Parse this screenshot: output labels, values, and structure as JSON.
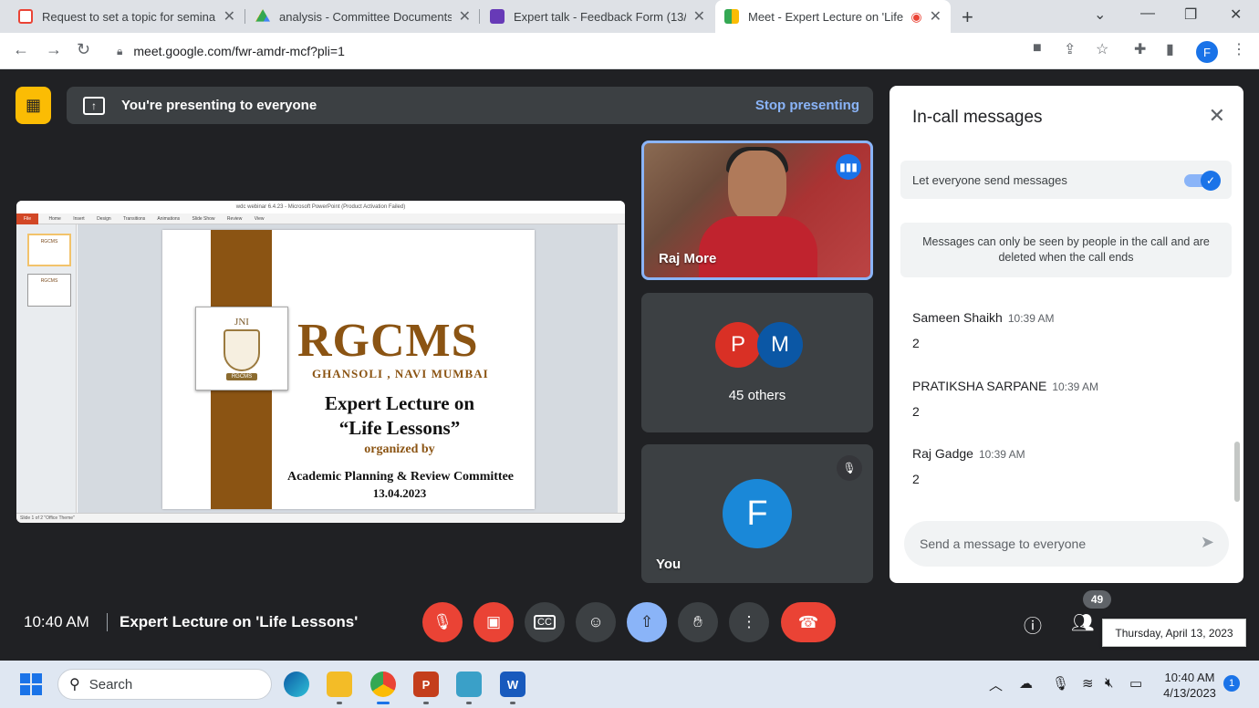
{
  "browser": {
    "tabs": [
      {
        "title": "Request to set a topic for semina",
        "favicon_color": "#ea4335"
      },
      {
        "title": "analysis - Committee Documents",
        "favicon_color": "#34a853"
      },
      {
        "title": "Expert talk - Feedback Form (13/",
        "favicon_color": "#673ab7"
      },
      {
        "title": "Meet - Expert Lecture on 'Life",
        "favicon_color": "#00897b"
      }
    ],
    "new_tab": "+",
    "url": "meet.google.com/fwr-amdr-mcf?pli=1",
    "profile_initial": "F"
  },
  "presenting": {
    "message": "You're presenting to everyone",
    "stop_label": "Stop presenting"
  },
  "slide": {
    "window_title": "wdc webinar 6.4.23 - Microsoft PowerPoint (Product Activation Failed)",
    "ribbon": [
      "File",
      "Home",
      "Insert",
      "Design",
      "Transitions",
      "Animations",
      "Slide Show",
      "Review",
      "View"
    ],
    "status": "Slide 1 of 2   \"Office Theme\"",
    "logo_top": "JNI",
    "logo_bottom": "RGCMS",
    "brand": "RGCMS",
    "location": "GHANSOLI , NAVI MUMBAI",
    "line1": "Expert Lecture on",
    "line2": "“Life Lessons”",
    "line3": "organized by",
    "line4": "Academic Planning & Review Committee",
    "line5": "13.04.2023",
    "thumb1": "RGCMS",
    "thumb2": "RGCMS"
  },
  "tiles": {
    "speaker_name": "Raj More",
    "others_initials": [
      "P",
      "M"
    ],
    "others_colors": [
      "#d93025",
      "#0b57a5"
    ],
    "others_label": "45 others",
    "you_initial": "F",
    "you_label": "You"
  },
  "chat": {
    "title": "In-call messages",
    "toggle_label": "Let everyone send messages",
    "toggle_on": true,
    "info": "Messages can only be seen by people in the call and are deleted when the call ends",
    "messages": [
      {
        "sender": "Sameen Shaikh",
        "time": "10:39 AM",
        "text": "2"
      },
      {
        "sender": "PRATIKSHA SARPANE",
        "time": "10:39 AM",
        "text": "2"
      },
      {
        "sender": "Raj Gadge",
        "time": "10:39 AM",
        "text": "2"
      }
    ],
    "input_placeholder": "Send a message to everyone"
  },
  "meeting": {
    "time": "10:40 AM",
    "name": "Expert Lecture on 'Life Lessons'",
    "participant_count": "49",
    "tooltip": "Thursday, April 13, 2023"
  },
  "taskbar": {
    "search_label": "Search",
    "time": "10:40 AM",
    "date": "4/13/2023",
    "notifications": "1"
  }
}
